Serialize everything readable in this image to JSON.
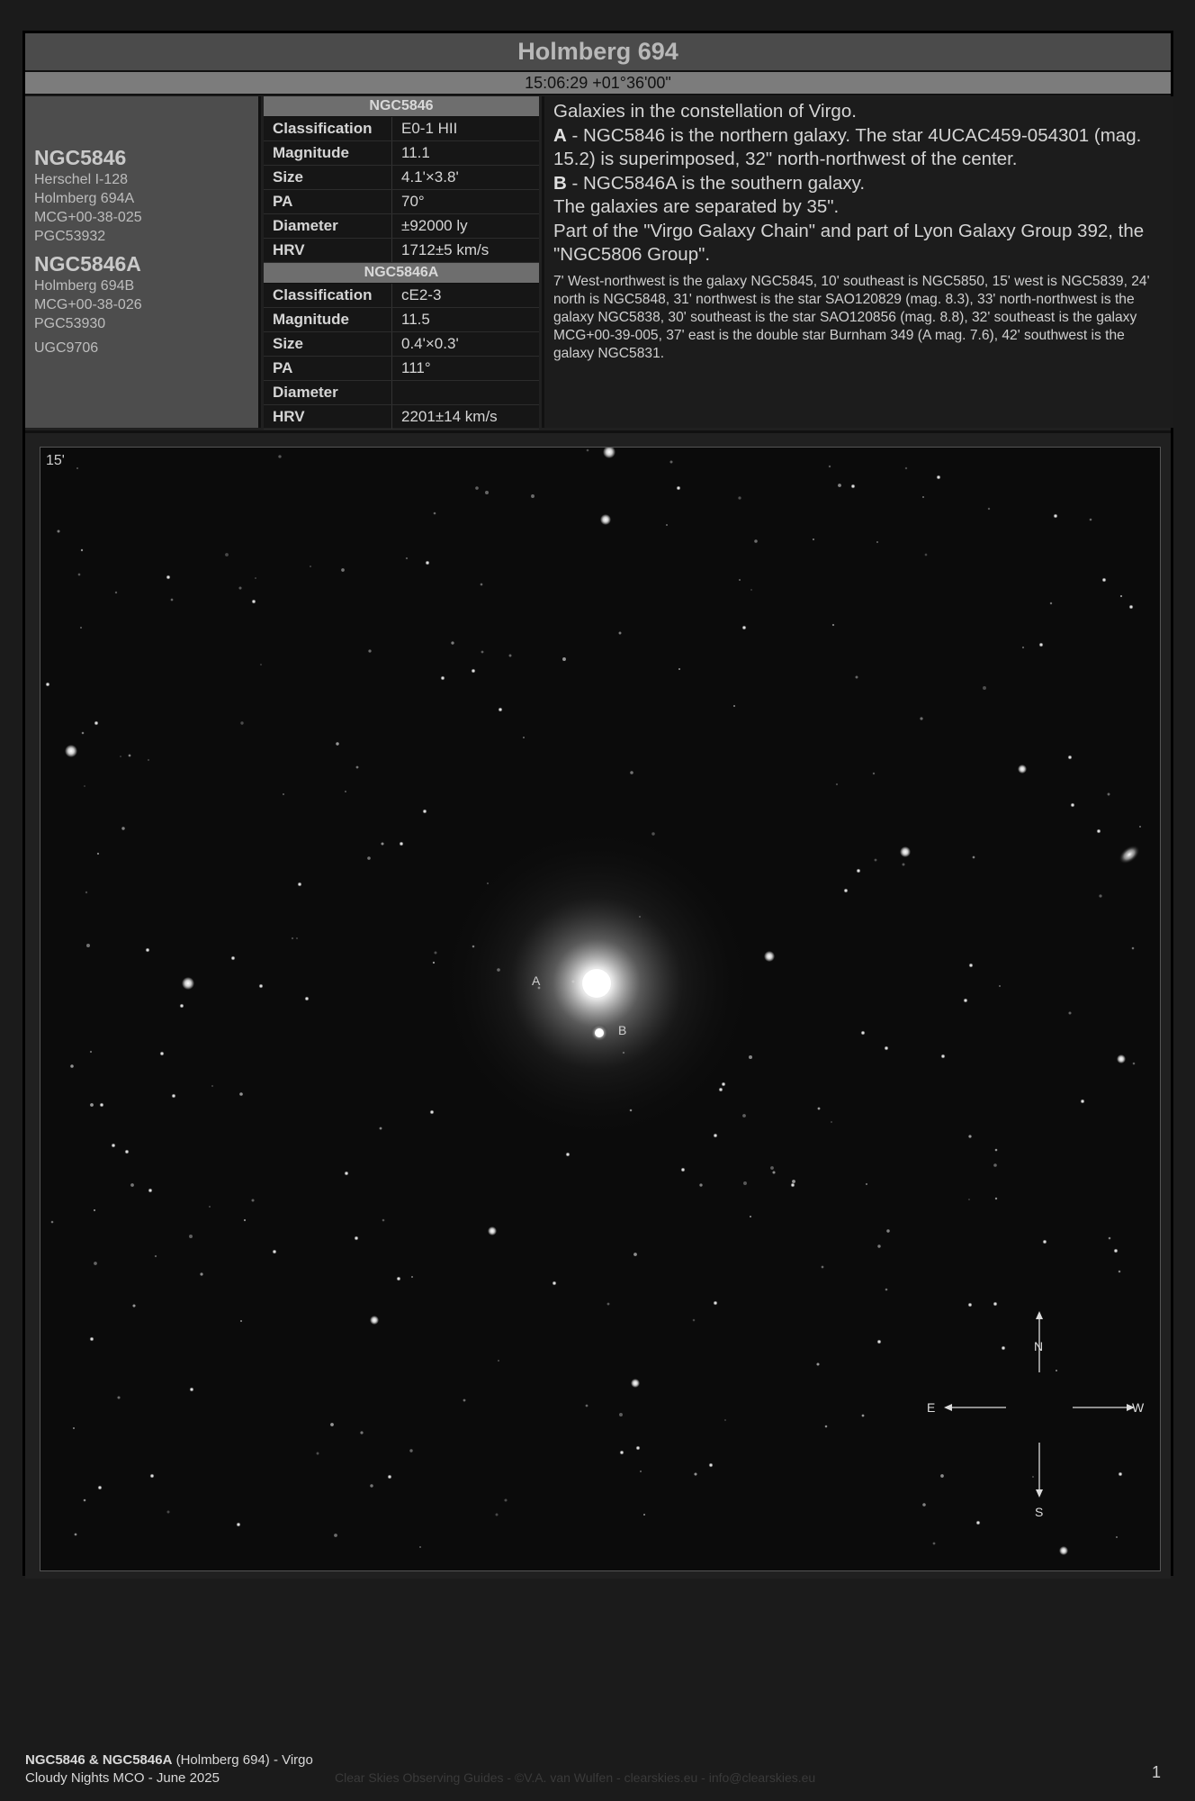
{
  "header": {
    "title": "Holmberg 694",
    "coords": "15:06:29 +01°36'00\""
  },
  "names": {
    "primary": {
      "name": "NGC5846",
      "aliases": [
        "Herschel I-128",
        "Holmberg 694A",
        "MCG+00-38-025",
        "PGC53932"
      ]
    },
    "secondary": {
      "name": "NGC5846A",
      "aliases": [
        "Holmberg 694B",
        "MCG+00-38-026",
        "PGC53930",
        "UGC9706"
      ]
    }
  },
  "props": {
    "ngc5846": {
      "title": "NGC5846",
      "rows": [
        {
          "key": "Classification",
          "value": "E0-1 HII"
        },
        {
          "key": "Magnitude",
          "value": "11.1"
        },
        {
          "key": "Size",
          "value": "4.1'×3.8'"
        },
        {
          "key": "PA",
          "value": "70°"
        },
        {
          "key": "Diameter",
          "value": "±92000 ly"
        },
        {
          "key": "HRV",
          "value": "1712±5 km/s"
        }
      ]
    },
    "ngc5846a": {
      "title": "NGC5846A",
      "rows": [
        {
          "key": "Classification",
          "value": "cE2-3"
        },
        {
          "key": "Magnitude",
          "value": "11.5"
        },
        {
          "key": "Size",
          "value": "0.4'×0.3'"
        },
        {
          "key": "PA",
          "value": "111°"
        },
        {
          "key": "Diameter",
          "value": ""
        },
        {
          "key": "HRV",
          "value": "2201±14 km/s"
        }
      ]
    }
  },
  "description": {
    "intro": "Galaxies in the constellation of Virgo.",
    "a_label": "A",
    "a_text": " - NGC5846 is the northern galaxy. The star 4UCAC459-054301 (mag. 15.2) is superimposed, 32\" north-northwest of the center.",
    "b_label": "B",
    "b_text": " - NGC5846A is the southern galaxy.",
    "separation": "The galaxies are separated by 35\".",
    "group": "Part of the \"Virgo Galaxy Chain\" and part of Lyon Galaxy Group 392, the \"NGC5806 Group\".",
    "surroundings": "7' West-northwest is the galaxy NGC5845, 10' southeast is NGC5850, 15' west is NGC5839, 24' north is NGC5848, 31' northwest is the star SAO120829 (mag. 8.3), 33' north-northwest is the galaxy NGC5838, 30' southeast is the star SAO120856 (mag. 8.8), 32' southeast is the galaxy MCG+00-39-005, 37' east is the double star Burnham 349 (A mag. 7.6), 42' southwest is the galaxy NGC5831."
  },
  "image": {
    "scale": "15'",
    "label_a": "A",
    "label_b": "B",
    "compass": {
      "n": "N",
      "s": "S",
      "e": "E",
      "w": "W"
    }
  },
  "footer": {
    "title_bold": "NGC5846 & NGC5846A",
    "title_rest": " (Holmberg 694) - Virgo",
    "line2": "Cloudy Nights MCO - June 2025",
    "credit": "Clear Skies Observing Guides - ©V.A. van Wulfen - clearskies.eu - info@clearskies.eu",
    "page": "1"
  }
}
